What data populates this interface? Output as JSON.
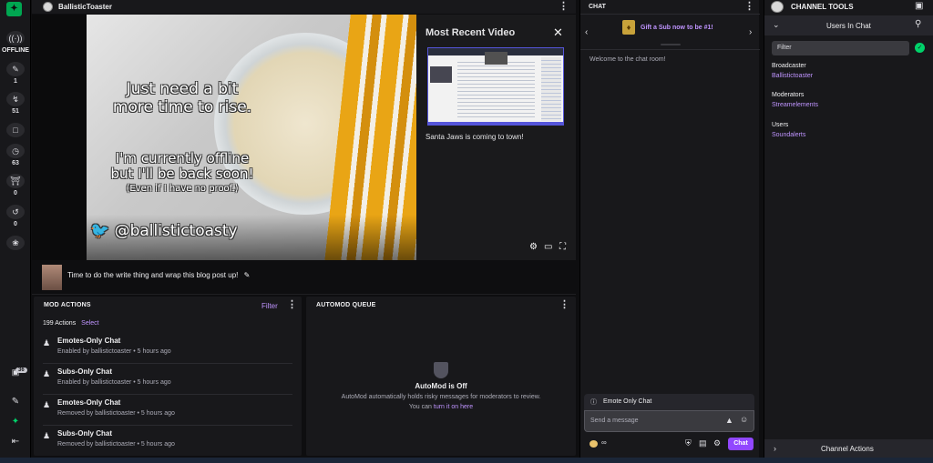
{
  "rail": {
    "status": "OFFLINE",
    "items": [
      {
        "icon": "broadcast-icon",
        "count": ""
      },
      {
        "icon": "pen-icon",
        "count": "1"
      },
      {
        "icon": "lightning-icon",
        "count": "51"
      },
      {
        "icon": "chat-icon",
        "count": ""
      },
      {
        "icon": "clock-icon",
        "count": "63"
      },
      {
        "icon": "shield-icon",
        "count": "0"
      },
      {
        "icon": "history-icon",
        "count": "0"
      },
      {
        "icon": "badge-icon",
        "count": ""
      }
    ],
    "bottom_badge": "36"
  },
  "header": {
    "channel": "BallisticToaster"
  },
  "video": {
    "overlay_line1": "Just need a bit",
    "overlay_line2": "more time to rise.",
    "overlay_line3": "I'm currently offline",
    "overlay_line4": "but I'll be back soon!",
    "overlay_line5": "(Even if I have no proof.)",
    "overlay_handle": "@ballistictoasty",
    "recent_title": "Most Recent Video",
    "recent_caption": "Santa Jaws is coming to town!"
  },
  "stream": {
    "title": "Time to do the write thing and wrap this blog post up!"
  },
  "mod_actions": {
    "title": "MOD ACTIONS",
    "filter": "Filter",
    "count": "199 Actions",
    "select": "Select",
    "rows": [
      {
        "title": "Emotes-Only Chat",
        "sub": "Enabled by ballistictoaster • 5 hours ago"
      },
      {
        "title": "Subs-Only Chat",
        "sub": "Enabled by ballistictoaster • 5 hours ago"
      },
      {
        "title": "Emotes-Only Chat",
        "sub": "Removed by ballistictoaster • 5 hours ago"
      },
      {
        "title": "Subs-Only Chat",
        "sub": "Removed by ballistictoaster • 5 hours ago"
      }
    ]
  },
  "automod": {
    "title": "AUTOMOD QUEUE",
    "status": "AutoMod is Off",
    "desc": "AutoMod automatically holds risky messages for moderators to review.",
    "cta_prefix": "You can",
    "cta_link": "turn it on here"
  },
  "chat": {
    "title": "CHAT",
    "gift": "Gift a Sub now to be #1!",
    "welcome": "Welcome to the chat room!",
    "mode_banner": "Emote Only Chat",
    "placeholder": "Send a message",
    "points": "∞",
    "send": "Chat"
  },
  "tools": {
    "title": "CHANNEL TOOLS",
    "users_title": "Users In Chat",
    "filter_placeholder": "Filter",
    "groups": [
      {
        "label": "Broadcaster",
        "user": "Ballistictoaster"
      },
      {
        "label": "Moderators",
        "user": "Streamelements"
      },
      {
        "label": "Users",
        "user": "Soundalerts"
      }
    ],
    "footer": "Channel Actions"
  },
  "colors": {
    "accent": "#9147ff",
    "link": "#bf94ff",
    "logo": "#00a651"
  }
}
